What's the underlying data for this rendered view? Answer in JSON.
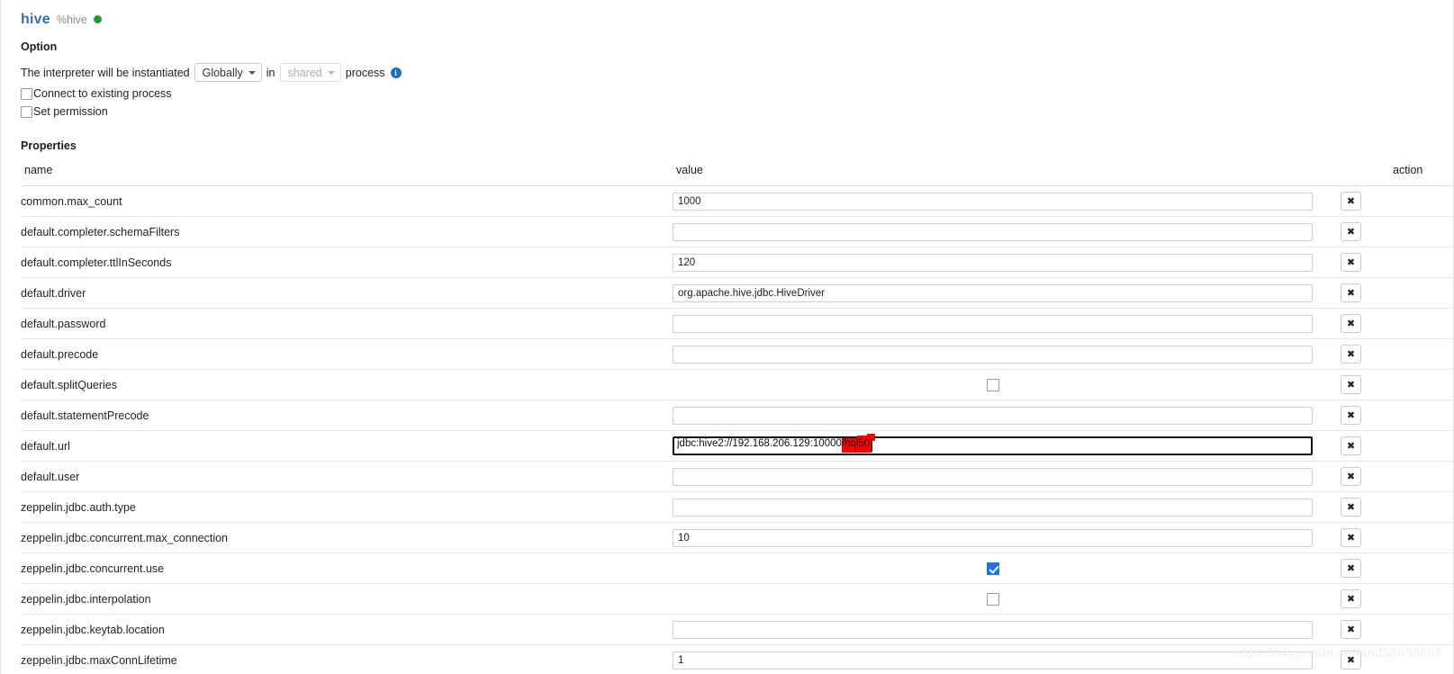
{
  "interpreter": {
    "name": "hive",
    "magic": "%hive",
    "status_color": "#1f9d2f",
    "status_label": "running-status-dot"
  },
  "option": {
    "title": "Option",
    "sentence_prefix": "The interpreter will be instantiated",
    "scope_value": "Globally",
    "sentence_middle": "in",
    "process_value": "shared",
    "sentence_suffix": "process",
    "info_glyph": "i",
    "checkboxes": [
      {
        "label": "Connect to existing process",
        "checked": false
      },
      {
        "label": "Set permission",
        "checked": false
      }
    ]
  },
  "properties": {
    "title": "Properties",
    "columns": {
      "name": "name",
      "value": "value",
      "action": "action"
    },
    "delete_glyph": "✖",
    "rows": [
      {
        "name": "common.max_count",
        "type": "text",
        "value": "1000"
      },
      {
        "name": "default.completer.schemaFilters",
        "type": "text",
        "value": ""
      },
      {
        "name": "default.completer.ttlInSeconds",
        "type": "text",
        "value": "120"
      },
      {
        "name": "default.driver",
        "type": "text",
        "value": "org.apache.hive.jdbc.HiveDriver"
      },
      {
        "name": "default.password",
        "type": "text",
        "value": ""
      },
      {
        "name": "default.precode",
        "type": "text",
        "value": ""
      },
      {
        "name": "default.splitQueries",
        "type": "checkbox",
        "value": false
      },
      {
        "name": "default.statementPrecode",
        "type": "text",
        "value": ""
      },
      {
        "name": "default.url",
        "type": "url-focused",
        "value": "jdbc:hive2://192.168.206.129:10000/hql50",
        "value_prefix": "jdbc:hive2://192.168.206.129:10000/",
        "value_highlighted": "hql50"
      },
      {
        "name": "default.user",
        "type": "text",
        "value": ""
      },
      {
        "name": "zeppelin.jdbc.auth.type",
        "type": "text",
        "value": ""
      },
      {
        "name": "zeppelin.jdbc.concurrent.max_connection",
        "type": "text",
        "value": "10"
      },
      {
        "name": "zeppelin.jdbc.concurrent.use",
        "type": "checkbox",
        "value": true
      },
      {
        "name": "zeppelin.jdbc.interpolation",
        "type": "checkbox",
        "value": false
      },
      {
        "name": "zeppelin.jdbc.keytab.location",
        "type": "text",
        "value": ""
      },
      {
        "name": "zeppelin.jdbc.maxConnLifetime",
        "type": "text",
        "value": "1"
      }
    ]
  },
  "watermark": "https://blog.csdn.net/and52606686"
}
